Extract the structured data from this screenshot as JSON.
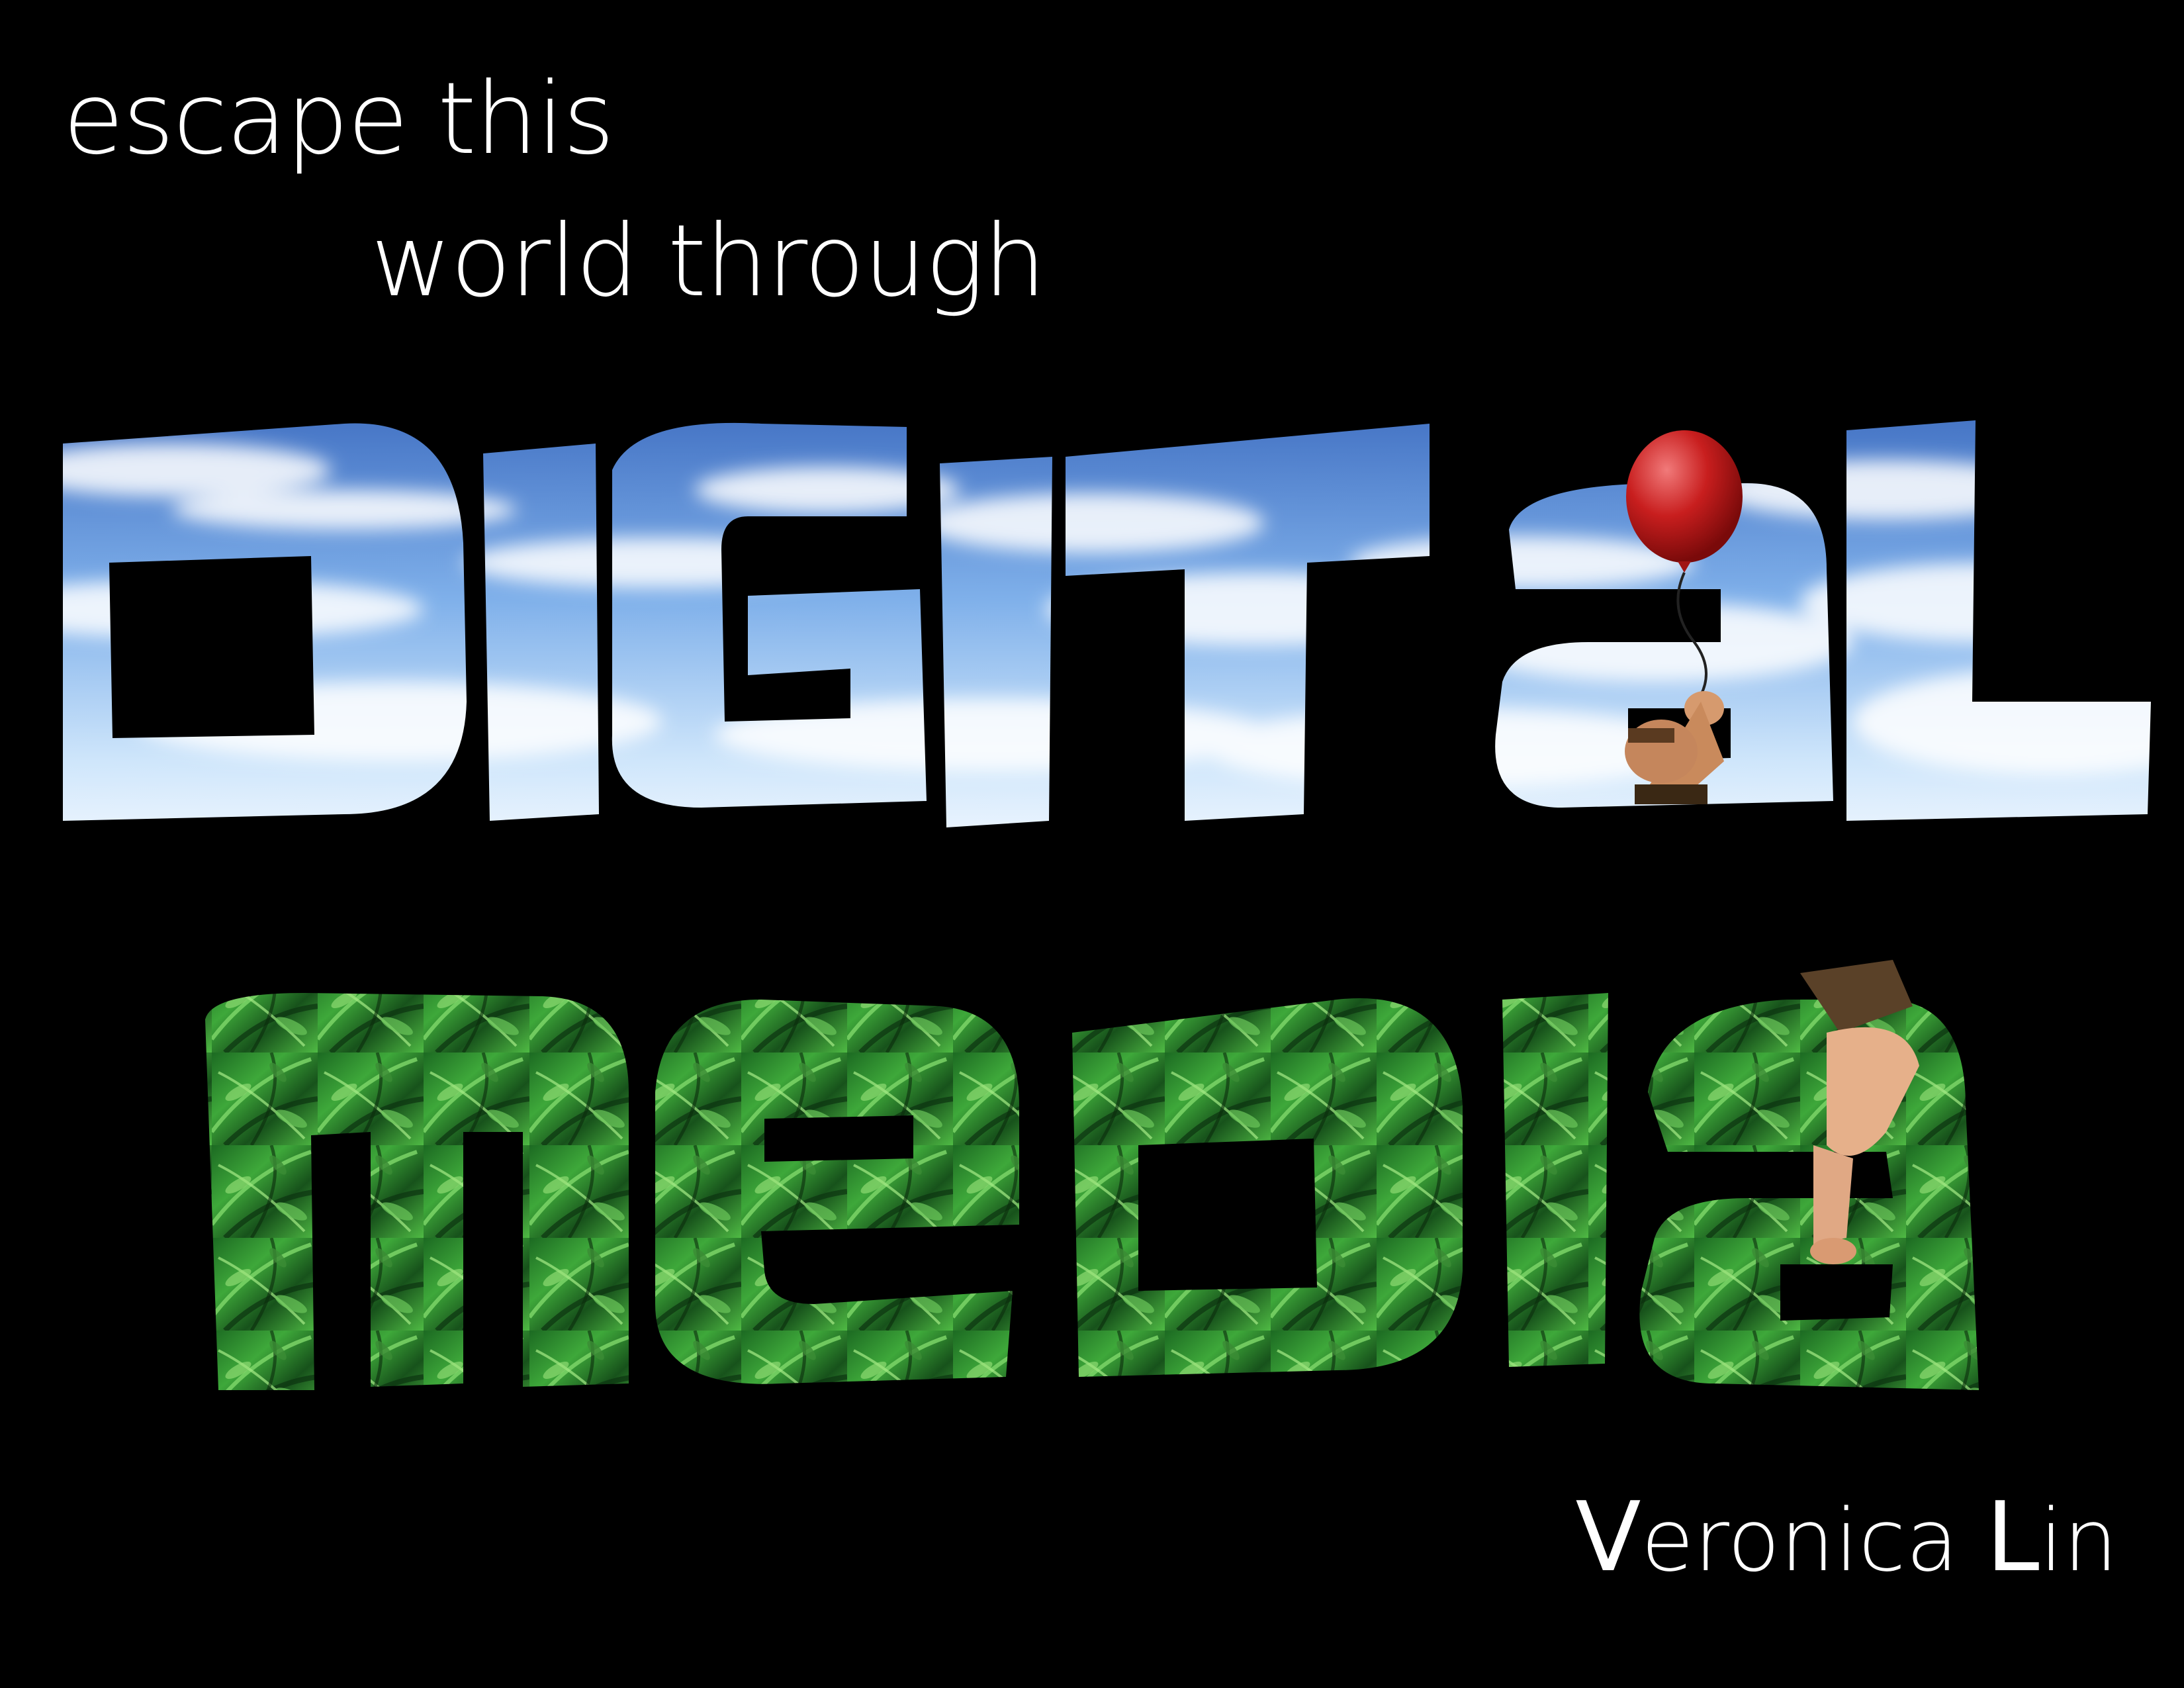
{
  "tagline": {
    "line1": "escape this",
    "line2": "world through"
  },
  "title": {
    "word1": "DIGITaL",
    "word2": "meDIa"
  },
  "author": {
    "first_initial": "V",
    "first_rest": "eronica",
    "last_initial": "L",
    "last_rest": "in"
  },
  "colors": {
    "background": "#000000",
    "text": "#ffffff",
    "sky_top": "#3f6fc4",
    "sky_bottom": "#e6f3ff",
    "jungle_dark": "#0d3a12",
    "jungle_light": "#5fc24a",
    "balloon": "#c81e1e"
  },
  "icons": {
    "balloon": "red-balloon-icon",
    "person": "swinging-man-figure"
  }
}
